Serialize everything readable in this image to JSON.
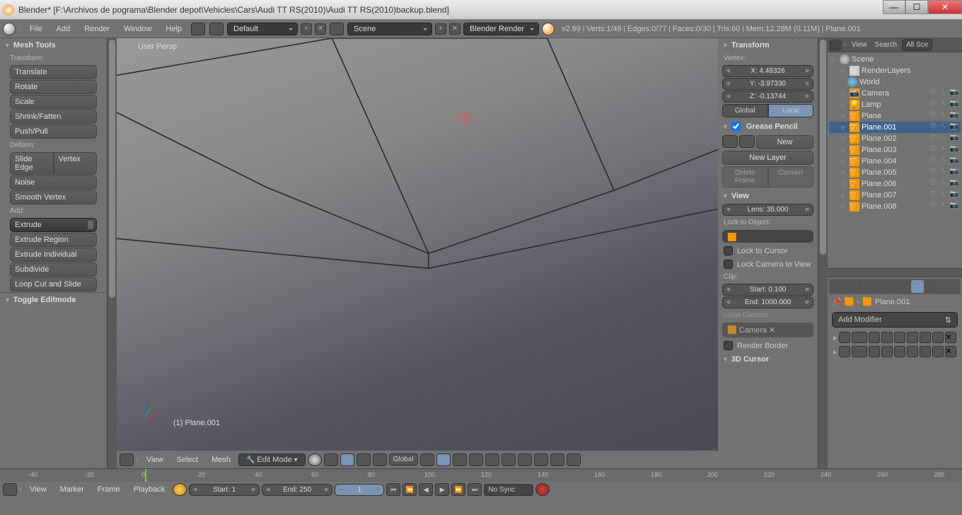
{
  "window": {
    "title": "Blender* [F:\\Archivos de pograma\\Blender depot\\Vehicles\\Cars\\Audi TT RS(2010)\\Audi TT RS(2010)backup.blend]"
  },
  "topmenu": {
    "file": "File",
    "add": "Add",
    "render": "Render",
    "window": "Window",
    "help": "Help",
    "layout": "Default",
    "scene": "Scene",
    "engine": "Blender Render"
  },
  "stats": {
    "version": "v2.69",
    "verts": "Verts:1/48",
    "edges": "Edges:0/77",
    "faces": "Faces:0/30",
    "tris": "Tris:60",
    "mem": "Mem:12.28M (0.11M)",
    "obj": "Plane.001"
  },
  "toolshelf": {
    "title": "Mesh Tools",
    "transform_lbl": "Transform:",
    "translate": "Translate",
    "rotate": "Rotate",
    "scale": "Scale",
    "shrink": "Shrink/Fatten",
    "pushpull": "Push/Pull",
    "deform_lbl": "Deform:",
    "slide": "Slide Edge",
    "vertex": "Vertex",
    "noise": "Noise",
    "smooth": "Smooth Vertex",
    "add_lbl": "Add:",
    "extrude": "Extrude",
    "ext_region": "Extrude Region",
    "ext_ind": "Extrude Individual",
    "subdivide": "Subdivide",
    "loopcut": "Loop Cut and Slide",
    "toggle": "Toggle Editmode"
  },
  "viewport": {
    "persp": "User Persp",
    "objname": "(1) Plane.001"
  },
  "npanel": {
    "transform": "Transform",
    "vertex_lbl": "Vertex:",
    "x": "X: 4.48326",
    "y": "Y: -3.97330",
    "z": "Z: -0.13744",
    "global": "Global",
    "local": "Local",
    "grease": "Grease Pencil",
    "new": "New",
    "newlayer": "New Layer",
    "delframe": "Delete Frame",
    "convert": "Convert",
    "view": "View",
    "lens": "Lens: 35.000",
    "lockobj": "Lock to Object:",
    "lockcursor": "Lock to Cursor",
    "lockcam": "Lock Camera to View",
    "clip": "Clip:",
    "clipstart": "Start: 0.100",
    "clipend": "End: 1000.000",
    "localcam": "Local Camera:",
    "camera": "Camera",
    "renderborder": "Render Border",
    "cursor3d": "3D Cursor"
  },
  "outliner": {
    "view": "View",
    "search": "Search",
    "allscenes": "All Sce",
    "scene": "Scene",
    "renderlayers": "RenderLayers",
    "world": "World",
    "camera": "Camera",
    "lamp": "Lamp",
    "plane": "Plane",
    "planes": [
      "Plane.001",
      "Plane.002",
      "Plane.003",
      "Plane.004",
      "Plane.005",
      "Plane.006",
      "Plane.007",
      "Plane.008"
    ]
  },
  "props": {
    "object": "Plane.001",
    "addmod": "Add Modifier"
  },
  "viewhdr": {
    "view": "View",
    "select": "Select",
    "mesh": "Mesh",
    "mode": "Edit Mode",
    "orient": "Global"
  },
  "timeline": {
    "view": "View",
    "marker": "Marker",
    "frame": "Frame",
    "playback": "Playback",
    "start": "Start: 1",
    "end": "End: 250",
    "cur": "1",
    "sync": "No Sync",
    "ticks": [
      -40,
      -20,
      0,
      20,
      40,
      60,
      80,
      100,
      120,
      140,
      160,
      180,
      200,
      220,
      240,
      260,
      280
    ]
  }
}
